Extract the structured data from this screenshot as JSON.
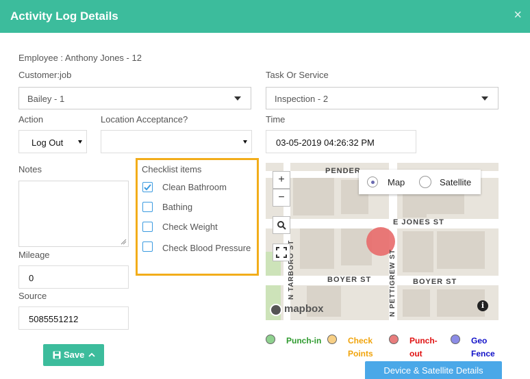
{
  "header": {
    "title": "Activity Log Details",
    "close_symbol": "×"
  },
  "employee_line": "Employee : Anthony Jones - 12",
  "customer_job": {
    "label": "Customer:job",
    "value": "Bailey - 1"
  },
  "task": {
    "label": "Task Or Service",
    "value": "Inspection - 2"
  },
  "action": {
    "label": "Action",
    "value": "Log Out"
  },
  "location": {
    "label": "Location Acceptance?",
    "value": ""
  },
  "time": {
    "label": "Time",
    "value": "03-05-2019 04:26:32 PM"
  },
  "notes": {
    "label": "Notes",
    "value": ""
  },
  "checklist": {
    "label": "Checklist items",
    "items": [
      {
        "label": "Clean Bathroom",
        "checked": true
      },
      {
        "label": "Bathing",
        "checked": false
      },
      {
        "label": "Check Weight",
        "checked": false
      },
      {
        "label": "Check Blood Pressure",
        "checked": false
      }
    ]
  },
  "mileage": {
    "label": "Mileage",
    "value": "0"
  },
  "source": {
    "label": "Source",
    "value": "5085551212"
  },
  "save": {
    "label": "Save"
  },
  "map": {
    "streets": [
      "PENDER",
      "E JONES ST",
      "BOYER ST",
      "BOYER ST",
      "N TARBORO ST",
      "N PETTIGREW ST"
    ],
    "zoom_in": "+",
    "zoom_out": "−",
    "type_options": [
      {
        "label": "Map",
        "selected": true
      },
      {
        "label": "Satellite",
        "selected": false
      }
    ],
    "attribution": "mapbox",
    "info_symbol": "i",
    "marker_color": "#e86a6a"
  },
  "legend": [
    {
      "label": "Punch-in",
      "color": "#2e9a2e",
      "dot": "#8fd18f"
    },
    {
      "label": "Check Points",
      "color": "#f0a30a",
      "dot": "#f7cf85"
    },
    {
      "label": "Punch-out",
      "color": "#e01010",
      "dot": "#e87d7d"
    },
    {
      "label": "Geo Fence",
      "color": "#1010c8",
      "dot": "#8c8ce6"
    }
  ],
  "device_button": {
    "label": "Device & Satellite Details"
  }
}
